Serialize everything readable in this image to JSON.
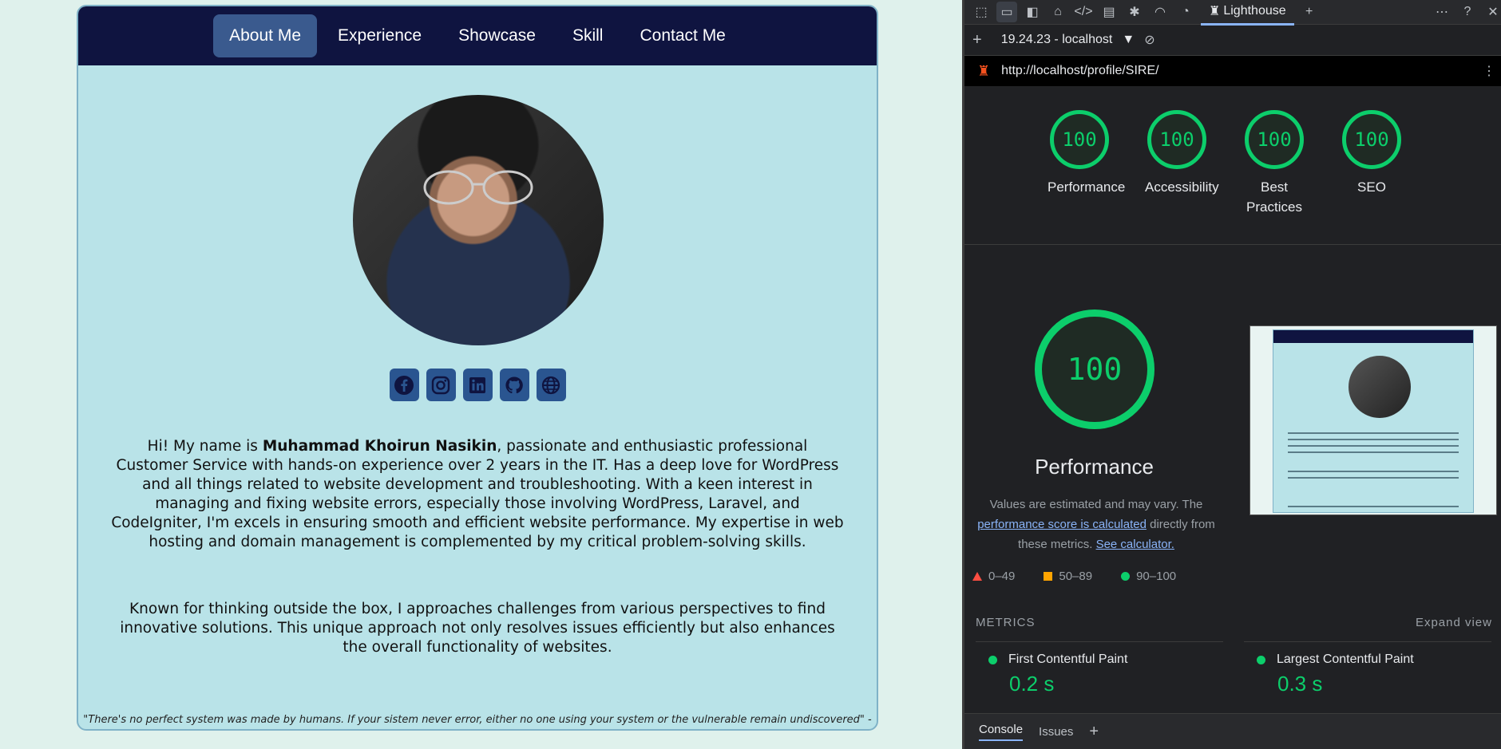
{
  "portfolio": {
    "nav": [
      "About Me",
      "Experience",
      "Showcase",
      "Skill",
      "Contact Me"
    ],
    "social_icons": [
      "facebook-icon",
      "instagram-icon",
      "linkedin-icon",
      "github-icon",
      "globe-icon"
    ],
    "intro_prefix": "Hi! My name is ",
    "intro_name": "Muhammad Khoirun Nasikin",
    "intro_rest": ", passionate and enthusiastic professional Customer Service with hands-on experience over 2 years in the IT. Has a deep love for WordPress and all things related to website development and troubleshooting. With a keen interest in managing and fixing website errors, especially those involving WordPress, Laravel, and CodeIgniter, I'm excels in ensuring smooth and efficient website performance. My expertise in web hosting and domain management is complemented by my critical problem-solving skills.",
    "para2": "Known for thinking outside the box, I approaches challenges from various perspectives to find innovative solutions. This unique approach not only resolves issues efficiently but also enhances the overall functionality of websites.",
    "quote": "\"There's no perfect system was made by humans. If your sistem never error, either no one using your system or the vulnerable remain undiscovered\" -",
    "colors": {
      "navbar": "#0f1440",
      "card": "#b9e3e8",
      "social": "#2a5590"
    }
  },
  "devtools": {
    "lighthouse_tab": "Lighthouse",
    "session": "19.24.23 - localhost",
    "url": "http://localhost/profile/SIRE/",
    "gauges": [
      {
        "score": "100",
        "label": "Performance"
      },
      {
        "score": "100",
        "label": "Accessibility"
      },
      {
        "score": "100",
        "label": "Best Practices"
      },
      {
        "score": "100",
        "label": "SEO"
      }
    ],
    "main_score": "100",
    "main_title": "Performance",
    "desc_1": "Values are estimated and may vary. The ",
    "desc_link": "performance score is calculated",
    "desc_2": " directly from these metrics. ",
    "desc_link2": "See calculator.",
    "legend": [
      "0–49",
      "50–89",
      "90–100"
    ],
    "legend_colors": [
      "#ff4e42",
      "#ffa400",
      "#0cce6b"
    ],
    "metrics_title": "METRICS",
    "expand": "Expand view",
    "metrics": [
      {
        "name": "First Contentful Paint",
        "value": "0.2 s"
      },
      {
        "name": "Largest Contentful Paint",
        "value": "0.3 s"
      }
    ],
    "drawer_tabs": [
      "Console",
      "Issues"
    ]
  }
}
